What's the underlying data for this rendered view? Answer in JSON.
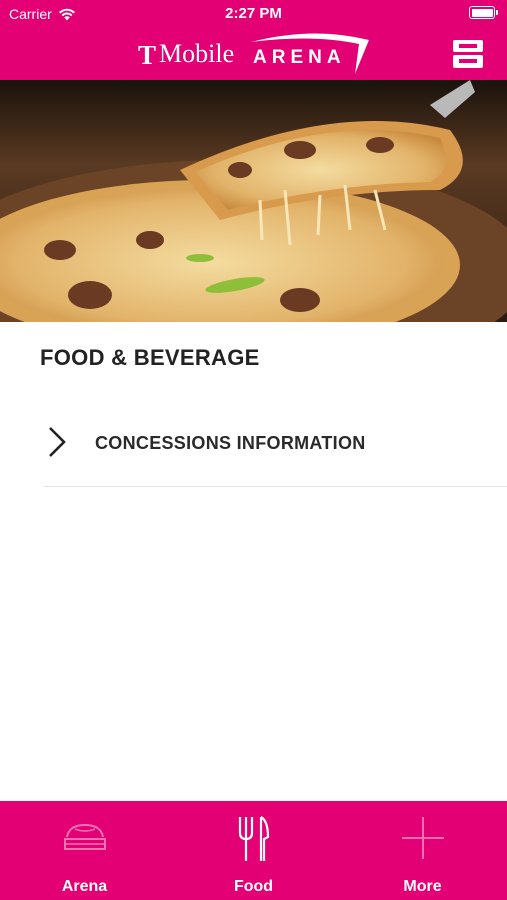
{
  "status_bar": {
    "carrier": "Carrier",
    "time": "2:27 PM"
  },
  "header": {
    "logo_t": "T",
    "logo_brand": "Mobile",
    "logo_arena": "ARENA",
    "menu_icon": "venue-menu-icon"
  },
  "hero": {
    "image": "pizza-photo"
  },
  "main": {
    "section_title": "FOOD & BEVERAGE",
    "items": [
      {
        "label": "CONCESSIONS INFORMATION",
        "icon": "chevron-right-icon"
      }
    ]
  },
  "tabbar": {
    "tabs": [
      {
        "label": "Arena",
        "icon": "arena-icon",
        "active": false
      },
      {
        "label": "Food",
        "icon": "fork-knife-icon",
        "active": true
      },
      {
        "label": "More",
        "icon": "plus-icon",
        "active": false
      }
    ]
  },
  "colors": {
    "brand_magenta": "#e20074",
    "text_dark": "#222222",
    "divider": "#e3e3e3"
  }
}
